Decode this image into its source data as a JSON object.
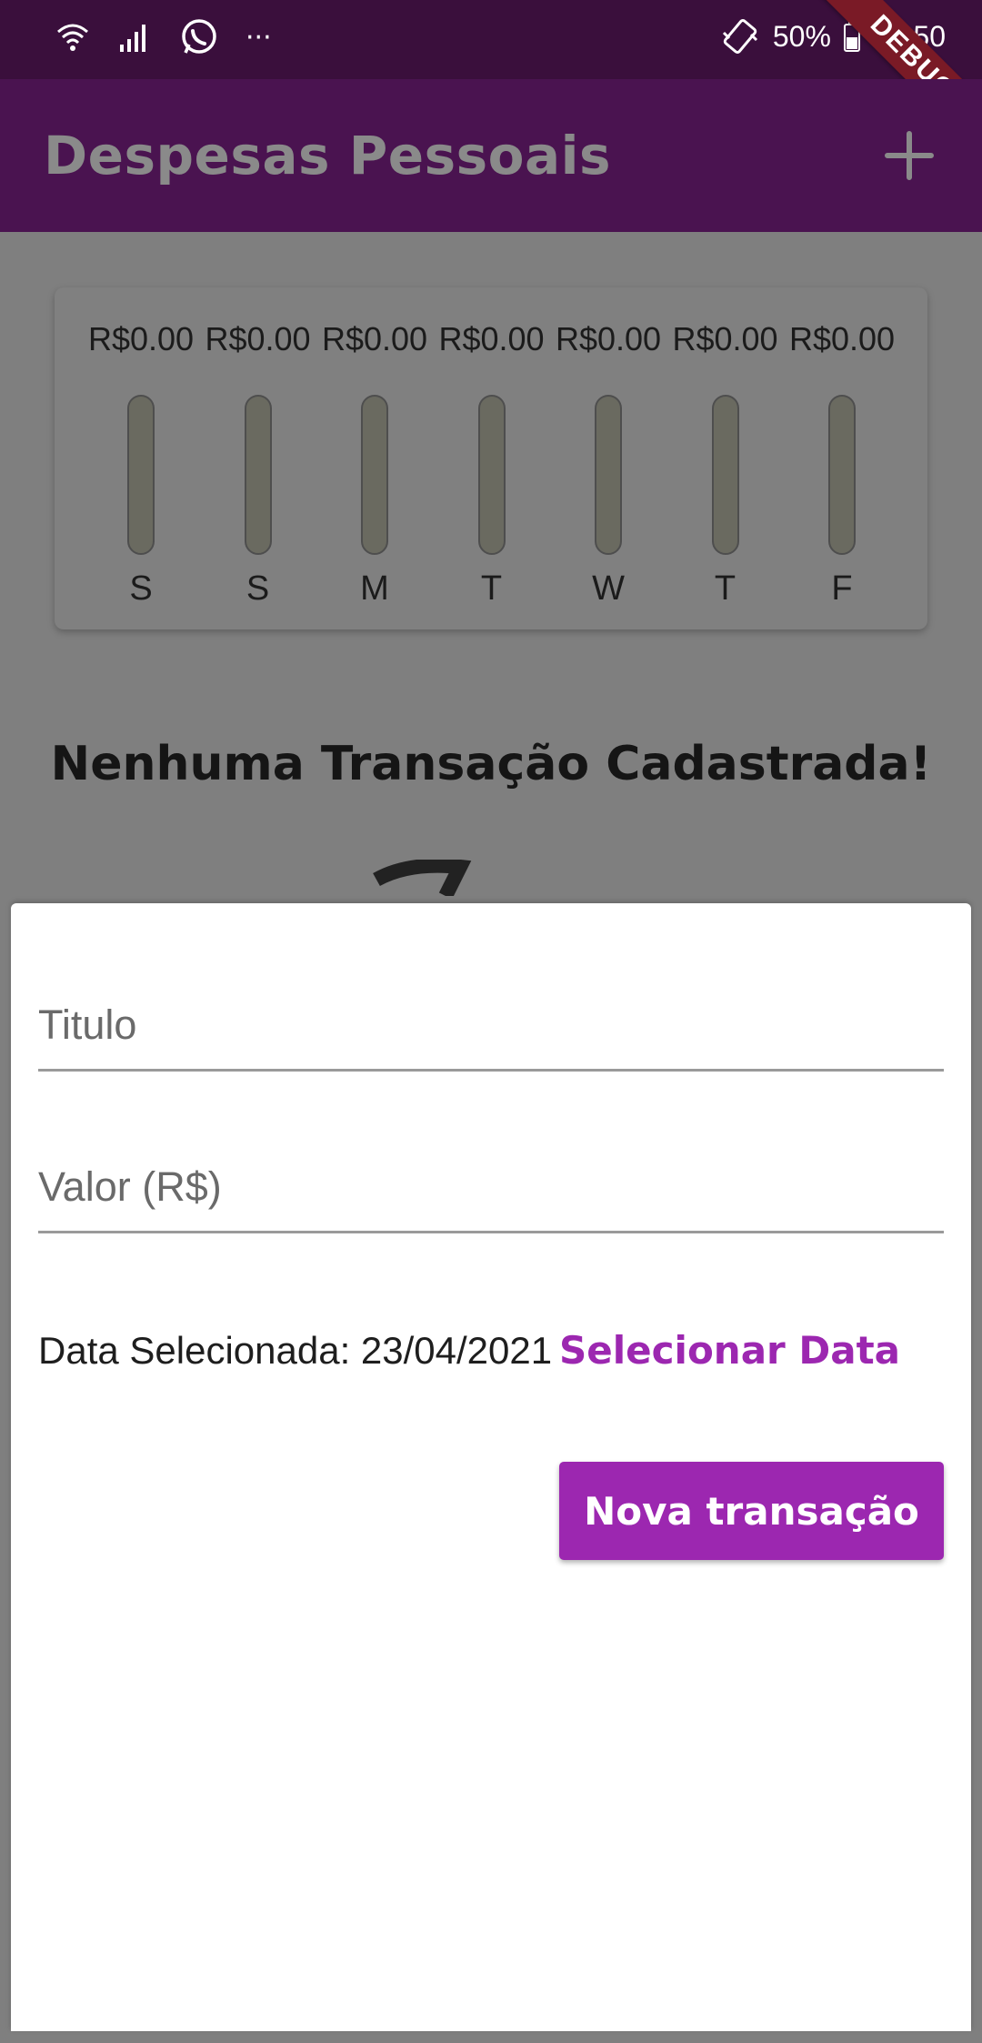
{
  "status_bar": {
    "battery": "50%",
    "time": "10:50",
    "left_icons": [
      "wifi-icon",
      "signal-icon",
      "whatsapp-icon",
      "more-icon"
    ],
    "more_glyph": "···"
  },
  "app_bar": {
    "title": "Despesas Pessoais",
    "add_icon": "plus-icon",
    "debug_label": "DEBUG",
    "bg_color": "#4a1350"
  },
  "chart_data": {
    "type": "bar",
    "categories": [
      "S",
      "S",
      "M",
      "T",
      "W",
      "T",
      "F"
    ],
    "values": [
      0,
      0,
      0,
      0,
      0,
      0,
      0
    ],
    "labels": [
      "R$0.00",
      "R$0.00",
      "R$0.00",
      "R$0.00",
      "R$0.00",
      "R$0.00",
      "R$0.00"
    ]
  },
  "empty_state": {
    "message": "Nenhuma Transação Cadastrada!"
  },
  "form": {
    "title_placeholder": "Titulo",
    "value_placeholder": "Valor (R$)",
    "date_label": "Data Selecionada: 23/04/2021",
    "select_date_label": "Selecionar Data",
    "submit_label": "Nova transação",
    "accent_color": "#9c27b0"
  }
}
